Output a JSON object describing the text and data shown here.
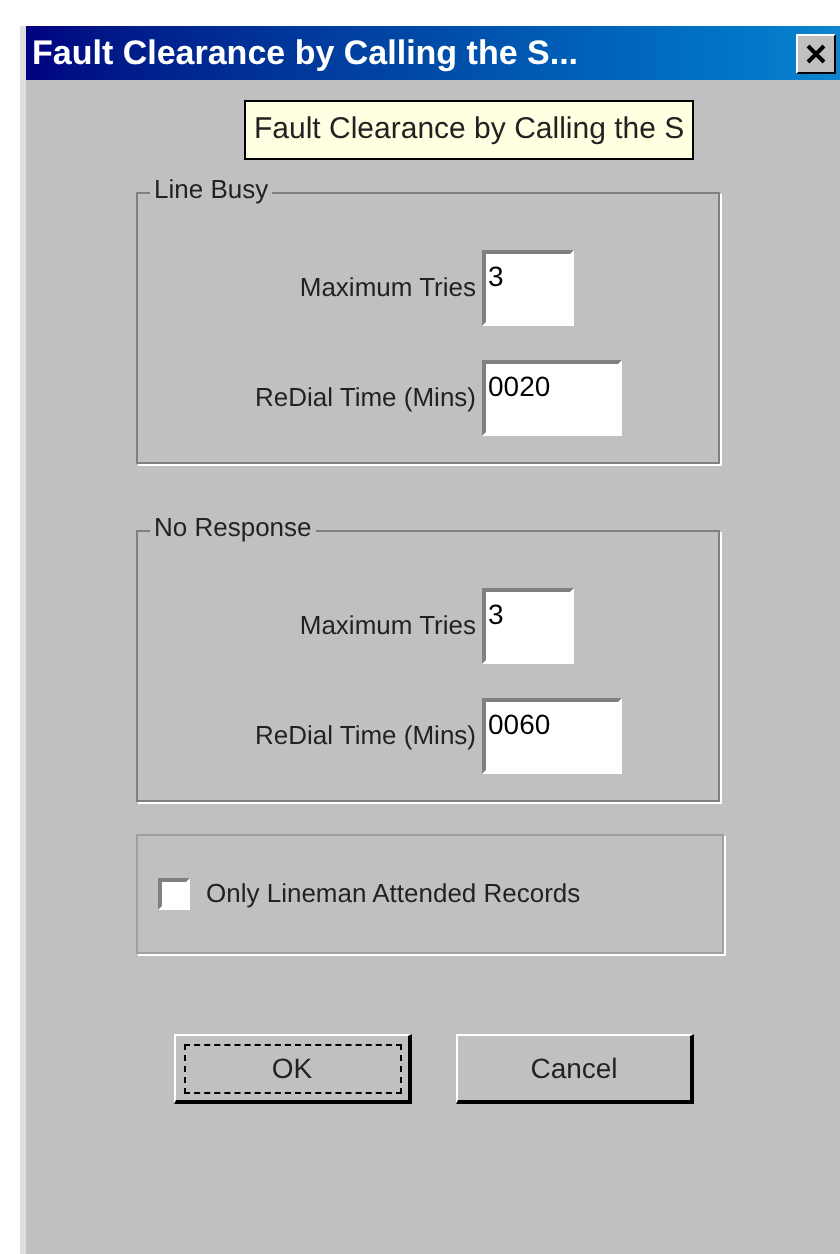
{
  "window": {
    "title": "Fault Clearance by Calling the S..."
  },
  "tooltip": "Fault Clearance by Calling the S",
  "groups": [
    {
      "title": "Line Busy",
      "fields": [
        {
          "label": "Maximum Tries",
          "value": "3",
          "wide": false
        },
        {
          "label": "ReDial Time (Mins)",
          "value": "0020",
          "wide": true
        }
      ]
    },
    {
      "title": "No Response",
      "fields": [
        {
          "label": "Maximum Tries",
          "value": "3",
          "wide": false
        },
        {
          "label": "ReDial Time (Mins)",
          "value": "0060",
          "wide": true
        }
      ]
    }
  ],
  "checkbox": {
    "label": "Only Lineman Attended Records",
    "checked": false
  },
  "buttons": [
    {
      "label": "OK",
      "default": true
    },
    {
      "label": "Cancel",
      "default": false
    }
  ]
}
